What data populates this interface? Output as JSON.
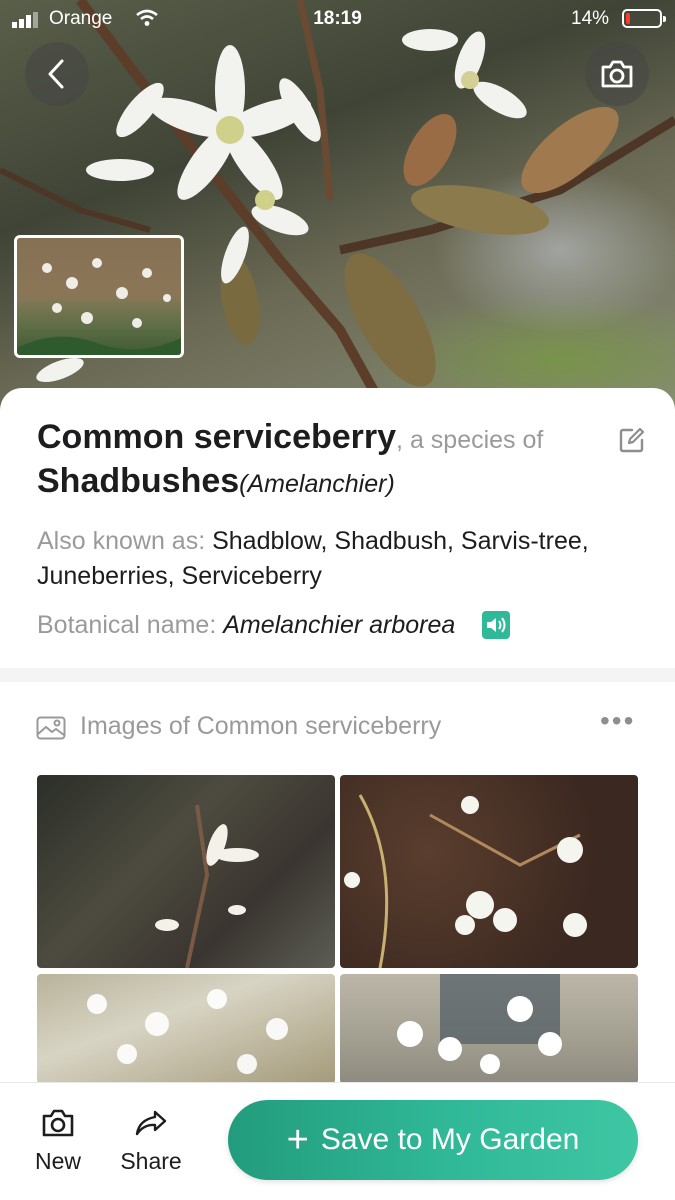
{
  "status_bar": {
    "carrier": "Orange",
    "time": "18:19",
    "battery": "14%",
    "battery_level": 0.14
  },
  "hero": {
    "back_icon": "chevron-left-icon",
    "camera_icon": "camera-icon"
  },
  "plant": {
    "common_name": "Common serviceberry",
    "species_of_text": ", a species of",
    "genus_common": "Shadbushes",
    "genus_scientific": "(Amelanchier)",
    "also_known_label": "Also known as: ",
    "also_known_value": "Shadblow, Shadbush, Sarvis-tree, Juneberries, Serviceberry",
    "botanical_label": "Botanical name: ",
    "botanical_value": "Amelanchier arborea"
  },
  "images": {
    "title": "Images of Common serviceberry",
    "more": "•••"
  },
  "bottom_bar": {
    "new_label": "New",
    "share_label": "Share",
    "save_label": "Save to My Garden",
    "save_plus": "+"
  },
  "colors": {
    "accent": "#30b998",
    "muted_text": "#9a9a9a",
    "battery_low": "#ff3b30"
  }
}
